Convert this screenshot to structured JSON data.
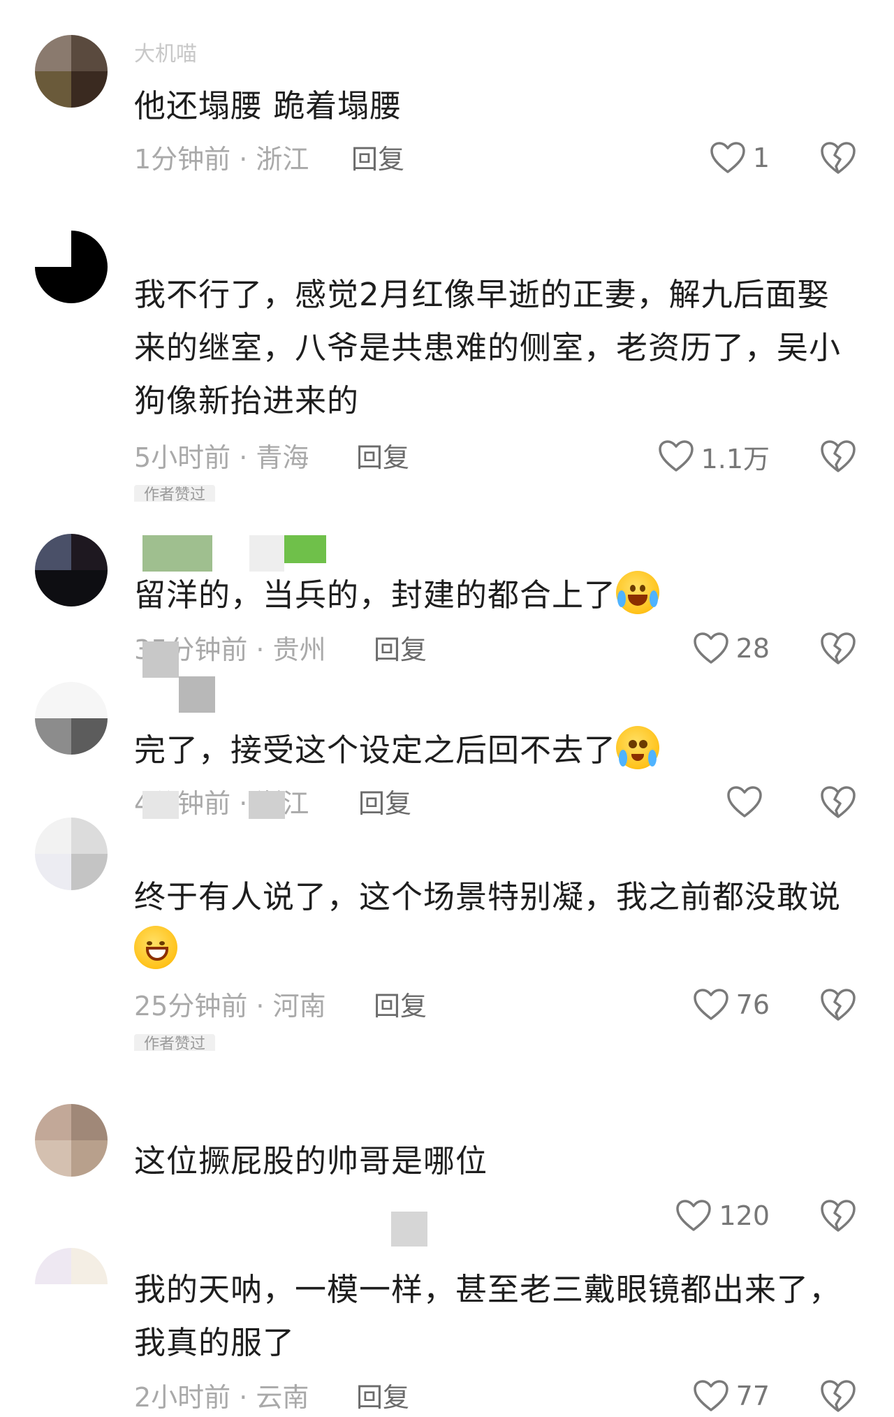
{
  "ui": {
    "reply_label": "回复",
    "author_tag": "作者赞过",
    "colors": {
      "text": "#1e1e1e",
      "meta": "#a9a9a9",
      "reply": "#6b6b6b",
      "icon": "#7a7a7a",
      "background": "#ffffff"
    },
    "icons": {
      "like": "heart-outline-icon",
      "dislike": "broken-heart-icon"
    }
  },
  "comments": [
    {
      "username": "大机喵",
      "text": "他还塌腰 跪着塌腰",
      "meta": "1分钟前 · 浙江",
      "likes": "1"
    },
    {
      "username": "",
      "text": "我不行了，感觉2月红像早逝的正妻，解九后面娶来的继室，八爷是共患难的侧室，老资历了，吴小狗像新抬进来的",
      "meta": "5小时前 · 青海",
      "likes": "1.1万"
    },
    {
      "username": "",
      "text": "留洋的，当兵的，封建的都合上了",
      "meta": "35分钟前 · 贵州",
      "likes": "28"
    },
    {
      "username": "",
      "text": "完了，接受这个设定之后回不去了",
      "meta": "4分钟前 · 浙江",
      "likes": ""
    },
    {
      "username": "",
      "text": "终于有人说了，这个场景特别凝，我之前都没敢说",
      "meta": "25分钟前 · 河南",
      "likes": "76"
    },
    {
      "username": "",
      "text": "这位撅屁股的帅哥是哪位",
      "meta": "",
      "likes": "120"
    },
    {
      "username": "",
      "text": "我的天呐，一模一样，甚至老三戴眼镜都出来了，我真的服了",
      "meta": "2小时前 · 云南",
      "likes": "77"
    }
  ]
}
